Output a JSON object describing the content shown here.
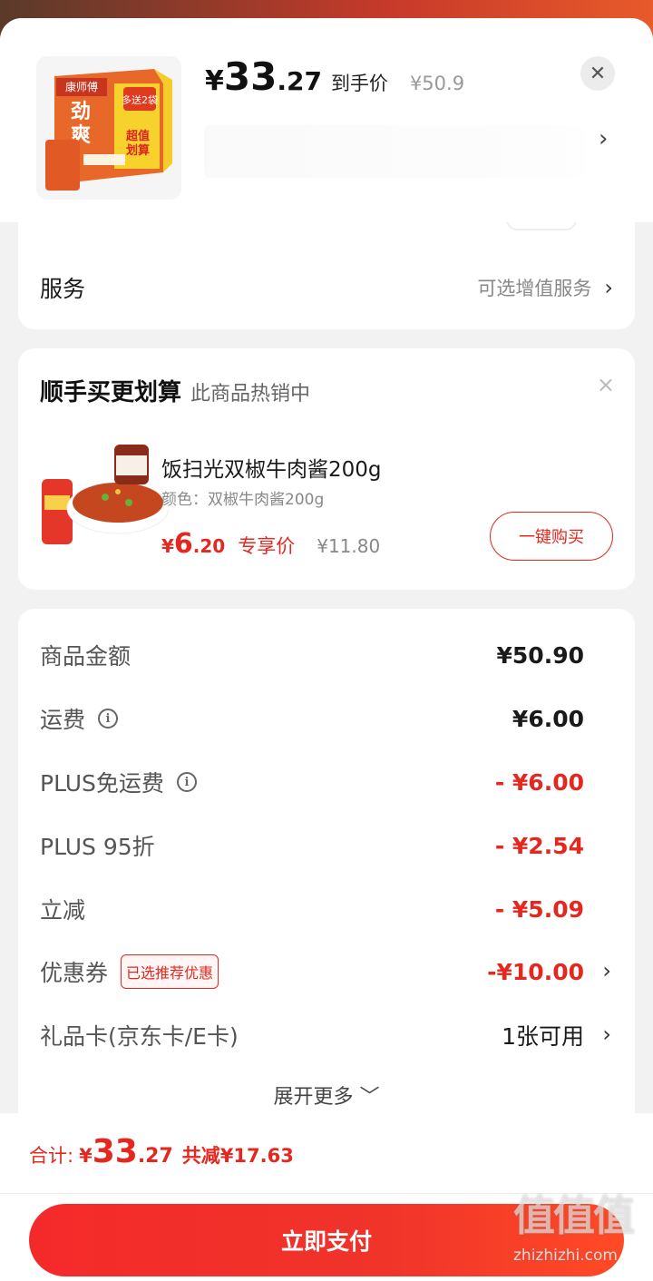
{
  "header": {
    "currency": "¥",
    "price_int": "33",
    "price_dec": ".27",
    "price_tag": "到手价",
    "orig_price": "¥50.9",
    "close_icon": "close-icon",
    "chevron": "›"
  },
  "service": {
    "label": "服务",
    "value": "可选增值服务",
    "chevron": "›"
  },
  "bundle": {
    "title": "顺手买更划算",
    "subtitle": "此商品热销中",
    "close": "×",
    "product_name": "饭扫光双椒牛肉酱200g",
    "product_color": "颜色：双椒牛肉酱200g",
    "currency": "¥",
    "price_int": "6",
    "price_dec": ".20",
    "price_tag": "专享价",
    "orig_price": "¥11.80",
    "buy_label": "一键购买"
  },
  "summary": {
    "rows": [
      {
        "label": "商品金额",
        "value": "¥50.90"
      },
      {
        "label": "运费",
        "value": "¥6.00"
      },
      {
        "label": "PLUS免运费",
        "value": "- ¥6.00"
      },
      {
        "label": "PLUS 95折",
        "value": "- ¥2.54"
      },
      {
        "label": "立减",
        "value": "- ¥5.09"
      },
      {
        "label": "优惠券",
        "value": "-¥10.00",
        "badge": "已选推荐优惠"
      },
      {
        "label": "礼品卡(京东卡/E卡)",
        "value": "1张可用"
      }
    ],
    "expand_label": "展开更多 ﹀",
    "chevron": "›",
    "info": "i"
  },
  "footer": {
    "total_label": "合计:",
    "currency": "¥",
    "total_int": "33",
    "total_dec": ".27",
    "saved": "共减¥17.63",
    "pay_label": "立即支付"
  },
  "watermark": {
    "chars": "值值值",
    "url": "zhizhizhi.com"
  },
  "colors": {
    "accent": "#e4281f",
    "background": "#f2f2f2"
  }
}
